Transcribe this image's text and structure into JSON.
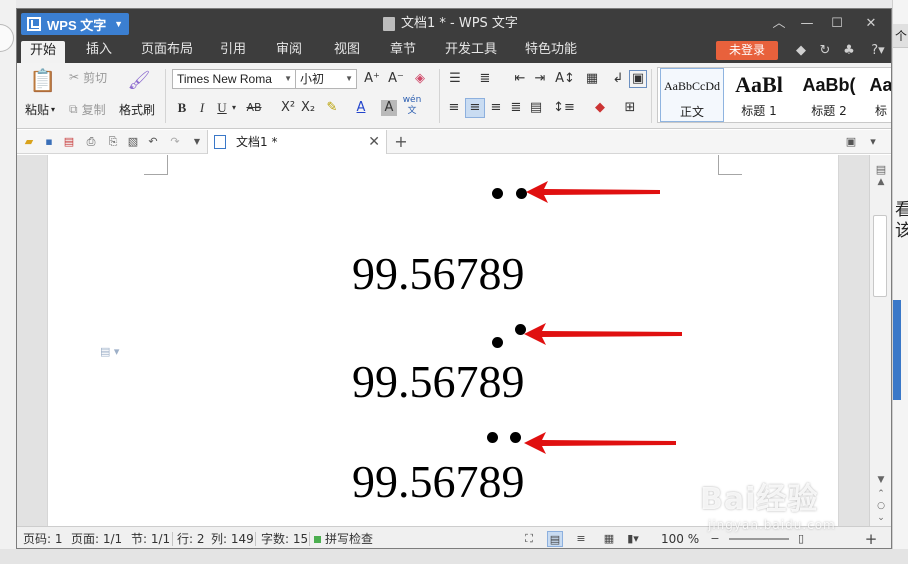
{
  "app": {
    "name": "WPS 文字",
    "window_title": "文档1 * - WPS 文字"
  },
  "menu": {
    "tabs": [
      "开始",
      "插入",
      "页面布局",
      "引用",
      "审阅",
      "视图",
      "章节",
      "开发工具",
      "特色功能"
    ],
    "active_tab": "开始",
    "login_label": "未登录"
  },
  "ribbon": {
    "clipboard": {
      "paste": "粘贴",
      "cut": "剪切",
      "copy": "复制",
      "format_painter": "格式刷"
    },
    "font": {
      "name": "Times New Roma",
      "size": "小初",
      "bold": "B",
      "italic": "I",
      "underline": "U",
      "strikethrough": "AB",
      "superscript": "X²",
      "subscript": "X₂",
      "font_color": "A",
      "char_shade": "A",
      "phonetic": "wén文"
    },
    "styles": [
      {
        "sample": "AaBbCcDd",
        "label": "正文"
      },
      {
        "sample": "AaBl",
        "label": "标题 1"
      },
      {
        "sample": "AaBb(",
        "label": "标题 2"
      },
      {
        "sample": "Aa",
        "label": "标"
      }
    ]
  },
  "document": {
    "tab_label": "文档1 *",
    "lines": [
      "99.56789",
      "99.56789",
      "99.56789"
    ],
    "annotation_color": "#e01010"
  },
  "status": {
    "page": "页码: 1",
    "pages": "页面: 1/1",
    "section": "节: 1/1",
    "row": "行: 2",
    "col": "列: 149",
    "word_count": "字数: 15",
    "spell_check": "拼写检查",
    "zoom": "100 %"
  },
  "side_panel": {
    "tab": "个",
    "text": "看该"
  },
  "watermark": {
    "main": "Bai经验",
    "sub": "jingyan.baidu.com"
  }
}
